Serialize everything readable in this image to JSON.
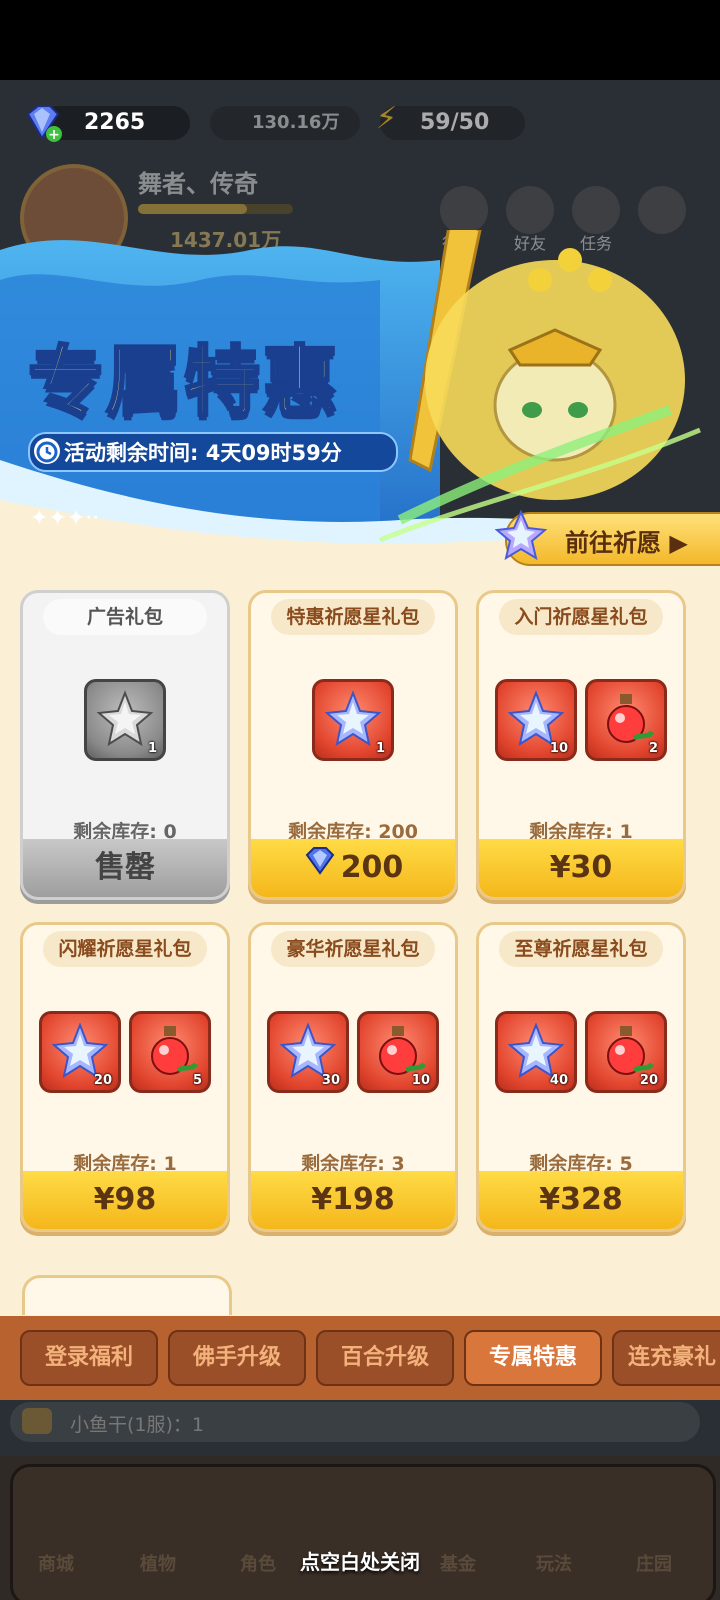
{
  "top_resources": {
    "diamonds": "2265",
    "coins": "130.16万",
    "energy": "59/50"
  },
  "player": {
    "name": "舞者、传奇",
    "power": "1437.01万"
  },
  "top_menu": [
    "行榜",
    "好友",
    "任务"
  ],
  "banner": {
    "title": "专属特惠",
    "timer": "活动剩余时间: 4天09时59分",
    "wish_button": "前往祈愿 ▶"
  },
  "packs": [
    {
      "title": "广告礼包",
      "items": [
        {
          "icon": "gray-star-icon",
          "count": "1"
        }
      ],
      "stock": "剩余库存: 0",
      "price": "售罄",
      "sold_out": true
    },
    {
      "title": "特惠祈愿星礼包",
      "items": [
        {
          "icon": "wish-star-icon",
          "count": "1"
        }
      ],
      "stock": "剩余库存: 200",
      "price": "200",
      "price_icon": "diamond-icon"
    },
    {
      "title": "入门祈愿星礼包",
      "items": [
        {
          "icon": "wish-star-icon",
          "count": "10"
        },
        {
          "icon": "potion-icon",
          "count": "2"
        }
      ],
      "stock": "剩余库存: 1",
      "price": "¥30"
    },
    {
      "title": "闪耀祈愿星礼包",
      "items": [
        {
          "icon": "wish-star-icon",
          "count": "20"
        },
        {
          "icon": "potion-icon",
          "count": "5"
        }
      ],
      "stock": "剩余库存: 1",
      "price": "¥98"
    },
    {
      "title": "豪华祈愿星礼包",
      "items": [
        {
          "icon": "wish-star-icon",
          "count": "30"
        },
        {
          "icon": "potion-icon",
          "count": "10"
        }
      ],
      "stock": "剩余库存: 3",
      "price": "¥198"
    },
    {
      "title": "至尊祈愿星礼包",
      "items": [
        {
          "icon": "wish-star-icon",
          "count": "40"
        },
        {
          "icon": "potion-icon",
          "count": "20"
        }
      ],
      "stock": "剩余库存: 5",
      "price": "¥328"
    }
  ],
  "tabs": [
    {
      "label": "登录福利",
      "active": false
    },
    {
      "label": "佛手升级",
      "active": false
    },
    {
      "label": "百合升级",
      "active": false
    },
    {
      "label": "专属特惠",
      "active": true
    },
    {
      "label": "连充豪礼",
      "active": false
    }
  ],
  "chat": {
    "text": "小鱼干(1服)：1"
  },
  "bottom_nav": [
    "商城",
    "植物",
    "角色",
    "",
    "基金",
    "玩法",
    "庄园"
  ],
  "close_hint": "点空白处关闭",
  "colors": {
    "accent": "#f4b71b",
    "panel": "#fbf0d6",
    "tab": "#9a4f28",
    "tab_active": "#d9763b"
  }
}
